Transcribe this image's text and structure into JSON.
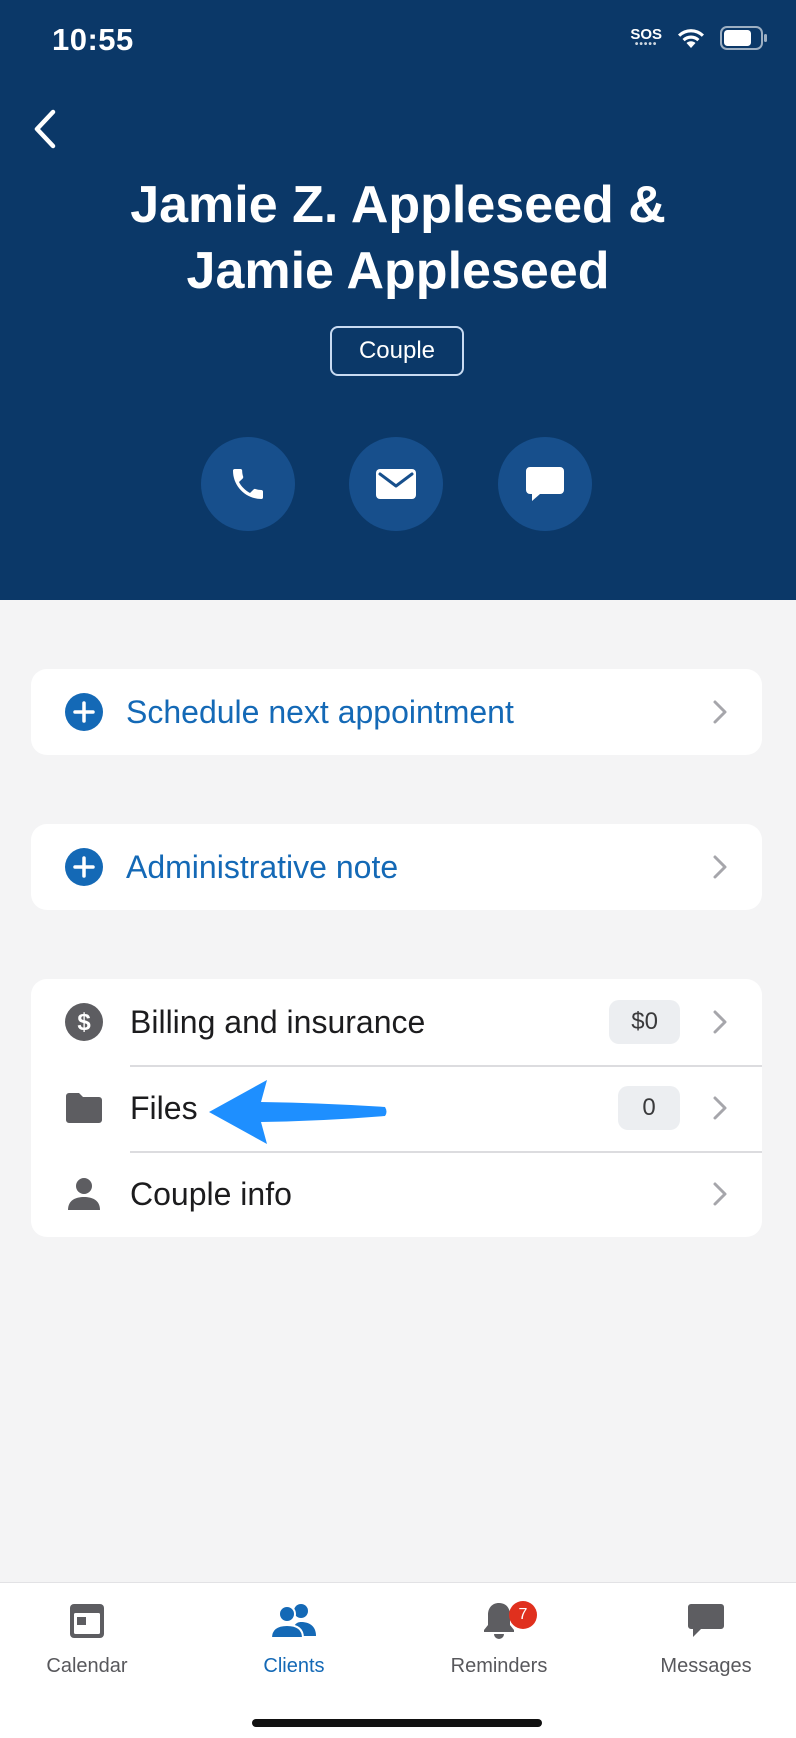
{
  "status_bar": {
    "time": "10:55",
    "sos": "SOS"
  },
  "client": {
    "name_line1": "Jamie Z. Appleseed &",
    "name_line2": "Jamie Appleseed",
    "type_badge": "Couple"
  },
  "contact_actions": [
    {
      "icon": "phone-icon"
    },
    {
      "icon": "mail-icon"
    },
    {
      "icon": "message-bubble-icon"
    }
  ],
  "actions": {
    "schedule_label": "Schedule next appointment",
    "admin_note_label": "Administrative note"
  },
  "details": {
    "billing_label": "Billing and insurance",
    "billing_value": "$0",
    "files_label": "Files",
    "files_count": "0",
    "couple_info_label": "Couple info"
  },
  "tab_bar": {
    "calendar_label": "Calendar",
    "clients_label": "Clients",
    "reminders_label": "Reminders",
    "reminders_badge": "7",
    "messages_label": "Messages",
    "active": "Clients"
  },
  "colors": {
    "header_bg": "#0b3868",
    "accent": "#1469b6",
    "annotation_arrow": "#1e8fff",
    "badge_red": "#e0301e"
  }
}
